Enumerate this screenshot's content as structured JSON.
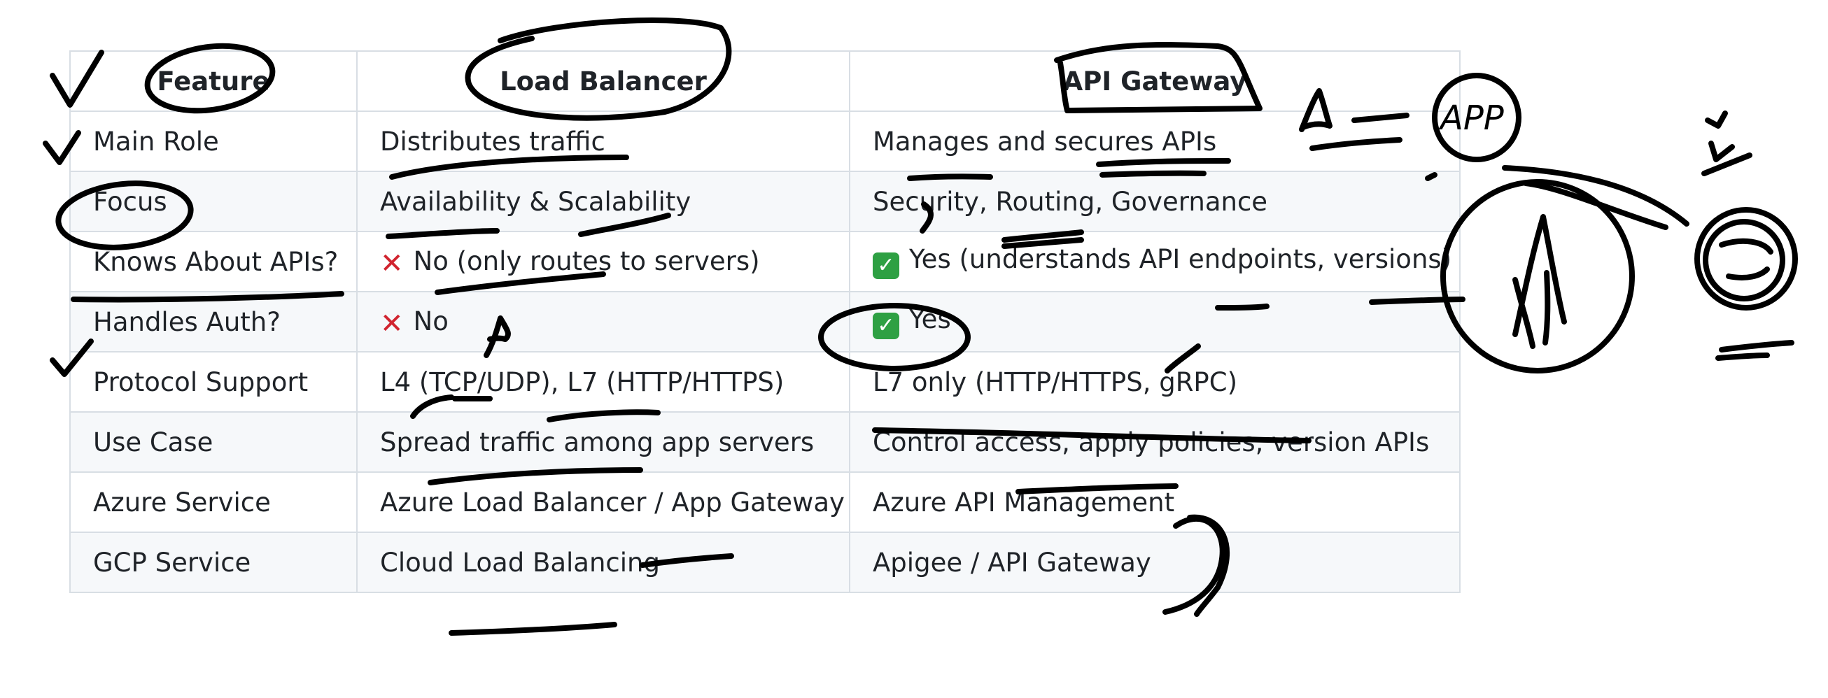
{
  "table": {
    "headers": [
      "Feature",
      "Load Balancer",
      "API Gateway"
    ],
    "rows": [
      {
        "feature": "Main Role",
        "lb": {
          "text": "Distributes traffic"
        },
        "gw": {
          "text": "Manages and secures APIs"
        }
      },
      {
        "feature": "Focus",
        "lb": {
          "text": "Availability & Scalability"
        },
        "gw": {
          "text": "Security, Routing, Governance"
        }
      },
      {
        "feature": "Knows About APIs?",
        "lb": {
          "icon": "cross-mark-icon",
          "text": "No (only routes to servers)"
        },
        "gw": {
          "icon": "check-mark-icon",
          "text": "Yes (understands API endpoints, versions)"
        }
      },
      {
        "feature": "Handles Auth?",
        "lb": {
          "icon": "cross-mark-icon",
          "text": "No"
        },
        "gw": {
          "icon": "check-mark-icon",
          "text": "Yes"
        }
      },
      {
        "feature": "Protocol Support",
        "lb": {
          "text": "L4 (TCP/UDP), L7 (HTTP/HTTPS)"
        },
        "gw": {
          "text": "L7 only (HTTP/HTTPS, gRPC)"
        }
      },
      {
        "feature": "Use Case",
        "lb": {
          "text": "Spread traffic among app servers"
        },
        "gw": {
          "text": "Control access, apply policies, version APIs"
        }
      },
      {
        "feature": "Azure Service",
        "lb": {
          "text": "Azure Load Balancer / App Gateway"
        },
        "gw": {
          "text": "Azure API Management"
        }
      },
      {
        "feature": "GCP Service",
        "lb": {
          "text": "Cloud Load Balancing"
        },
        "gw": {
          "text": "Apigee / API Gateway"
        }
      }
    ]
  },
  "annotations": {
    "sketch_label": "APP",
    "ink_color": "#000000"
  },
  "colors": {
    "cross": "#d1242f",
    "check": "#2ea043",
    "border": "#d8dee4",
    "stripe": "#f6f8fa"
  }
}
